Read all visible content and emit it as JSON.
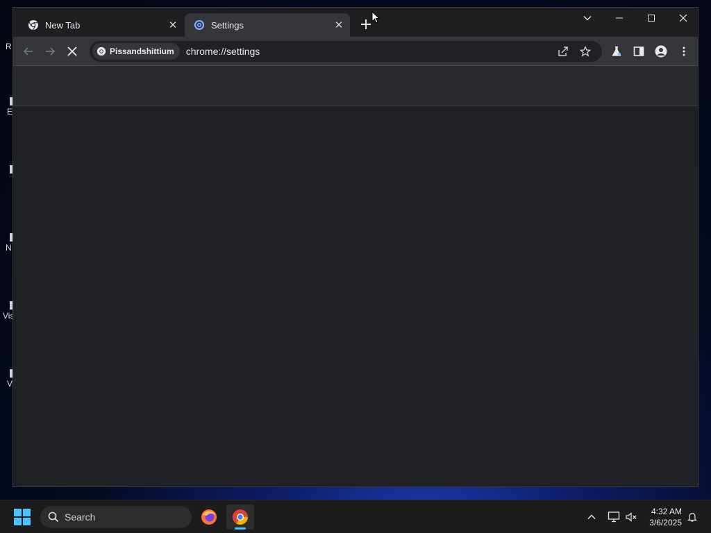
{
  "desktop": {
    "icons": [
      {
        "label": "R",
        "icon": "desktop-icon"
      },
      {
        "label": "E",
        "icon": "desktop-icon"
      },
      {
        "label": "",
        "icon": "desktop-icon"
      },
      {
        "label": "N",
        "icon": "desktop-icon"
      },
      {
        "label": "Vis",
        "icon": "desktop-icon"
      },
      {
        "label": "V",
        "icon": "desktop-icon"
      }
    ]
  },
  "browser": {
    "tabs": [
      {
        "title": "New Tab",
        "icon": "chrome-icon",
        "active": false
      },
      {
        "title": "Settings",
        "icon": "settings-gear-icon",
        "active": true
      }
    ],
    "omnibox": {
      "chip_label": "Pissandshittium",
      "url": "chrome://settings"
    },
    "loading": true
  },
  "taskbar": {
    "search_placeholder": "Search",
    "apps": [
      {
        "name": "firefox-icon"
      },
      {
        "name": "chromium-icon",
        "active": true
      }
    ],
    "clock": {
      "time": "4:32 AM",
      "date": "3/6/2025"
    }
  },
  "colors": {
    "window_bg": "#202124",
    "toolbar_bg": "#35363a",
    "accent": "#4cc2ff"
  }
}
